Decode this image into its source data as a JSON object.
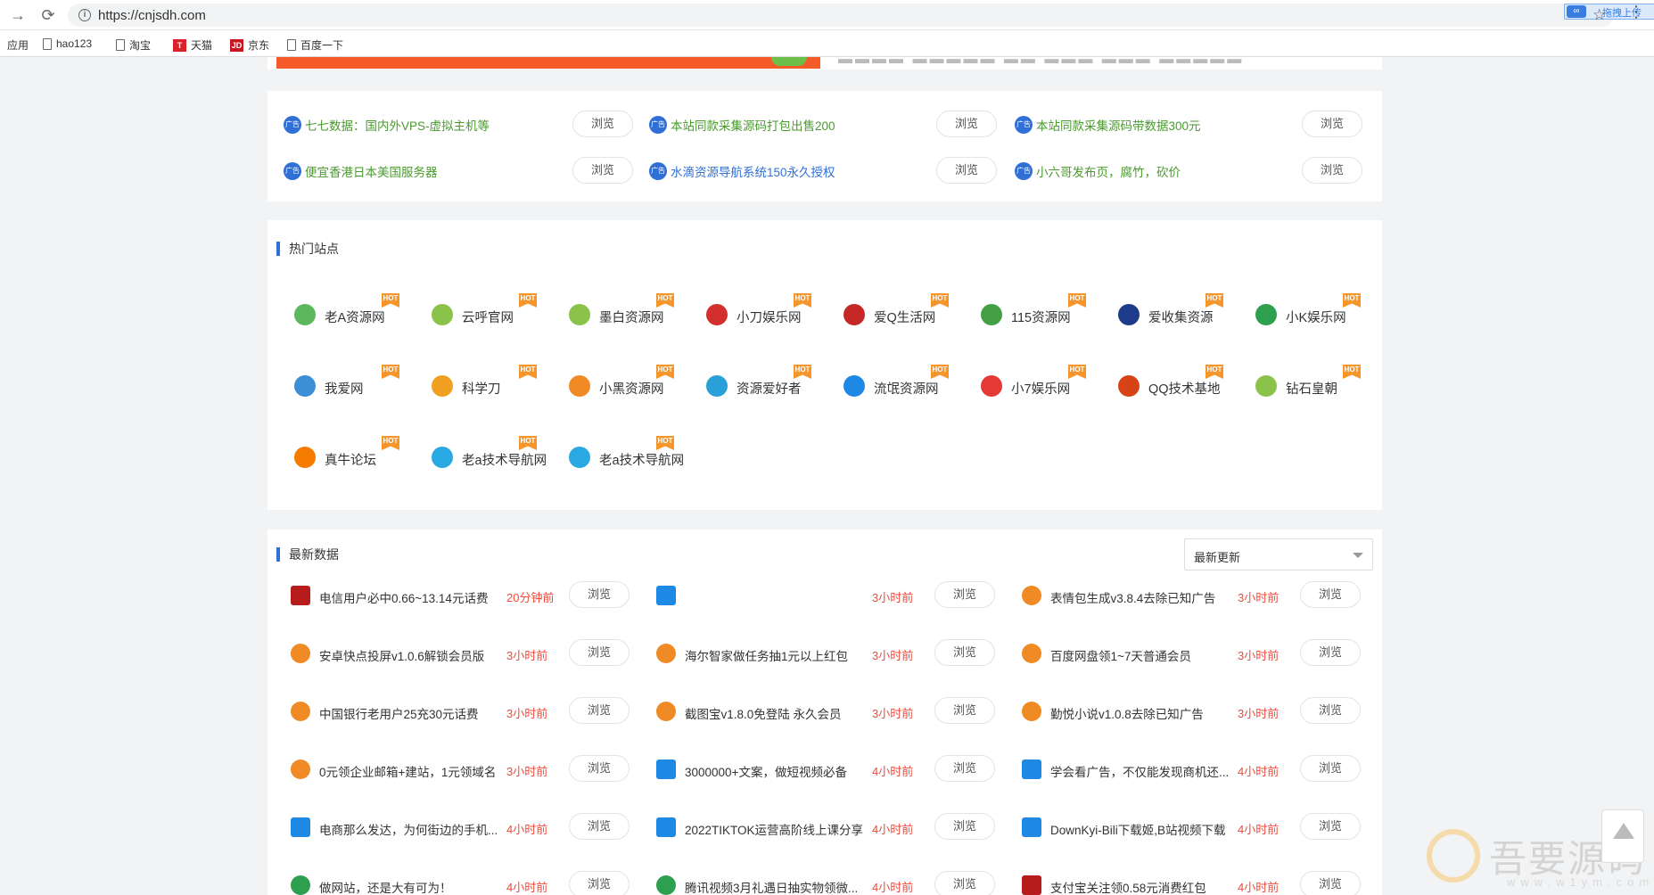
{
  "browser": {
    "url": "https://cnjsdh.com",
    "extension_label": "拖拽上传",
    "bookmarks": [
      {
        "label": "应用",
        "type": "text"
      },
      {
        "label": "hao123",
        "type": "doc"
      },
      {
        "label": "淘宝",
        "type": "doc"
      },
      {
        "label": "天猫",
        "type": "badge",
        "badge": "T",
        "color": "#d8232a"
      },
      {
        "label": "京东",
        "type": "badge",
        "badge": "JD",
        "color": "#c81623"
      },
      {
        "label": "百度一下",
        "type": "doc"
      }
    ]
  },
  "ads": {
    "button_label": "浏览",
    "badge_text": "广告",
    "items": [
      {
        "text": "七七数据：国内外VPS-虚拟主机等",
        "style": "green"
      },
      {
        "text": "本站同款采集源码打包出售200",
        "style": "green"
      },
      {
        "text": "本站同款采集源码带数据300元",
        "style": "green"
      },
      {
        "text": "便宜香港日本美国服务器",
        "style": "green"
      },
      {
        "text": "水滴资源导航系统150永久授权",
        "style": "blue"
      },
      {
        "text": "小六哥发布页，腐竹，砍价",
        "style": "green"
      }
    ]
  },
  "hot_sites": {
    "title": "热门站点",
    "hot_tag": "HOT",
    "items": [
      {
        "name": "老A资源网",
        "icon": "triangle-knot-icon",
        "color": "#5cb85c"
      },
      {
        "name": "云呼官网",
        "icon": "diamond-icon",
        "color": "#8bc34a"
      },
      {
        "name": "墨白资源网",
        "icon": "diamond-icon",
        "color": "#8bc34a"
      },
      {
        "name": "小刀娱乐网",
        "icon": "xiaodao-logo-icon",
        "color": "#d32f2f"
      },
      {
        "name": "爱Q生活网",
        "icon": "penguin-icon",
        "color": "#c62828"
      },
      {
        "name": "115资源网",
        "icon": "grid-icon",
        "color": "#43a047"
      },
      {
        "name": "爱收集资源",
        "icon": "globe-icon",
        "color": "#1e3a8a"
      },
      {
        "name": "小K娱乐网",
        "icon": "k-logo-icon",
        "color": "#2e9e4f"
      },
      {
        "name": "我爱网",
        "icon": "star-badge-icon",
        "color": "#3c8fd4"
      },
      {
        "name": "科学刀",
        "icon": "knife-icon",
        "color": "#f0a020"
      },
      {
        "name": "小黑资源网",
        "icon": "verified-badge-icon",
        "color": "#f08a24"
      },
      {
        "name": "资源爱好者",
        "icon": "swirl-icon",
        "color": "#2aa0d8"
      },
      {
        "name": "流氓资源网",
        "icon": "edge-icon",
        "color": "#1e88e5"
      },
      {
        "name": "小7娱乐网",
        "icon": "seven-icon",
        "color": "#e53935"
      },
      {
        "name": "QQ技术基地",
        "icon": "qq-penguin-icon",
        "color": "#d84315"
      },
      {
        "name": "钻石皇朝",
        "icon": "diamond-icon",
        "color": "#8bc34a"
      },
      {
        "name": "真牛论坛",
        "icon": "cross-box-icon",
        "color": "#f57c00"
      },
      {
        "name": "老a技术导航网",
        "icon": "water-drop-icon",
        "color": "#29a9e1"
      },
      {
        "name": "老a技术导航网",
        "icon": "water-drop-icon",
        "color": "#29a9e1"
      }
    ]
  },
  "latest": {
    "title": "最新数据",
    "sort_value": "最新更新",
    "button_label": "浏览",
    "items": [
      {
        "title": "电信用户必中0.66~13.14元话费",
        "time": "20分钟前",
        "icon": "xiaodao-logo-icon",
        "color": "#b71c1c"
      },
      {
        "title": "",
        "time": "3小时前",
        "icon": "edit-box-icon",
        "color": "#1e88e5"
      },
      {
        "title": "表情包生成v3.8.4去除已知广告",
        "time": "3小时前",
        "icon": "verified-badge-icon",
        "color": "#f08a24"
      },
      {
        "title": "安卓快点投屏v1.0.6解锁会员版",
        "time": "3小时前",
        "icon": "verified-badge-icon",
        "color": "#f08a24"
      },
      {
        "title": "海尔智家做任务抽1元以上红包",
        "time": "3小时前",
        "icon": "verified-badge-icon",
        "color": "#f08a24"
      },
      {
        "title": "百度网盘领1~7天普通会员",
        "time": "3小时前",
        "icon": "verified-badge-icon",
        "color": "#f08a24"
      },
      {
        "title": "中国银行老用户25充30元话费",
        "time": "3小时前",
        "icon": "verified-badge-icon",
        "color": "#f08a24"
      },
      {
        "title": "截图宝v1.8.0免登陆 永久会员",
        "time": "3小时前",
        "icon": "verified-badge-icon",
        "color": "#f08a24"
      },
      {
        "title": "勤悦小说v1.0.8去除已知广告",
        "time": "3小时前",
        "icon": "verified-badge-icon",
        "color": "#f08a24"
      },
      {
        "title": "0元领企业邮箱+建站，1元领域名",
        "time": "3小时前",
        "icon": "verified-badge-icon",
        "color": "#f08a24"
      },
      {
        "title": "3000000+文案，做短视频必备",
        "time": "4小时前",
        "icon": "edit-box-icon",
        "color": "#1e88e5"
      },
      {
        "title": "学会看广告，不仅能发现商机还...",
        "time": "4小时前",
        "icon": "edit-box-icon",
        "color": "#1e88e5"
      },
      {
        "title": "电商那么发达，为何街边的手机...",
        "time": "4小时前",
        "icon": "edit-box-icon",
        "color": "#1e88e5"
      },
      {
        "title": "2022TIKTOK运营高阶线上课分享",
        "time": "4小时前",
        "icon": "edit-box-icon",
        "color": "#1e88e5"
      },
      {
        "title": "DownKyi-Bili下载姬,B站视频下载",
        "time": "4小时前",
        "icon": "edit-box-icon",
        "color": "#1e88e5"
      },
      {
        "title": "做网站，还是大有可为！",
        "time": "4小时前",
        "icon": "k-logo-icon",
        "color": "#2e9e4f"
      },
      {
        "title": "腾讯视频3月礼遇日抽实物领微...",
        "time": "4小时前",
        "icon": "k-logo-icon",
        "color": "#2e9e4f"
      },
      {
        "title": "支付宝关注领0.58元消费红包",
        "time": "4小时前",
        "icon": "xiaodao-logo-icon",
        "color": "#b71c1c"
      }
    ]
  },
  "watermark": {
    "text": "吾要源码",
    "sub": "www.w1ym.com"
  }
}
